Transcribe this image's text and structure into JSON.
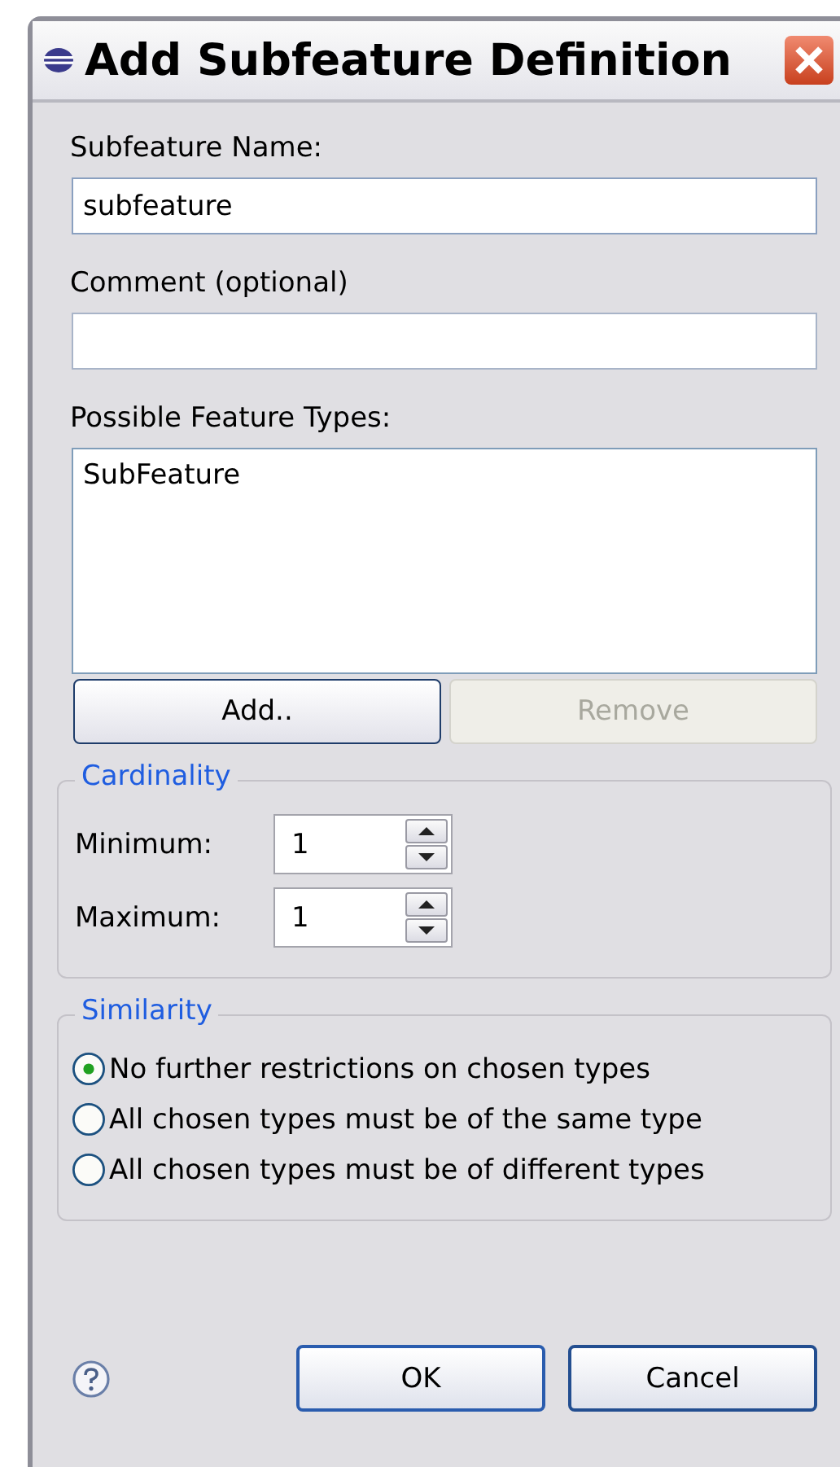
{
  "window": {
    "title": "Add Subfeature Definition"
  },
  "fields": [
    {
      "label": "Subfeature Name:",
      "value": "subfeature",
      "focused": true
    },
    {
      "label": "Comment (optional)",
      "focused": false
    }
  ],
  "feature_types": {
    "label": "Possible Feature Types:",
    "items": [
      "SubFeature"
    ],
    "buttons": [
      {
        "label": "Add..",
        "disabled": false
      },
      {
        "label": "Remove",
        "disabled": true
      }
    ]
  },
  "cardinality": {
    "title": "Cardinality",
    "spinners": [
      {
        "label": "Minimum:",
        "value": "1"
      },
      {
        "label": "Maximum:",
        "value": "1"
      }
    ]
  },
  "similarity": {
    "title": "Similarity",
    "options": [
      {
        "label": "No further restrictions on chosen types",
        "selected": true
      },
      {
        "label": "All chosen types must be of the same type",
        "selected": false
      },
      {
        "label": "All chosen types must be of different types",
        "selected": false
      }
    ]
  },
  "buttons": [
    {
      "label": "OK",
      "default": true
    },
    {
      "label": "Cancel",
      "default": false
    }
  ]
}
